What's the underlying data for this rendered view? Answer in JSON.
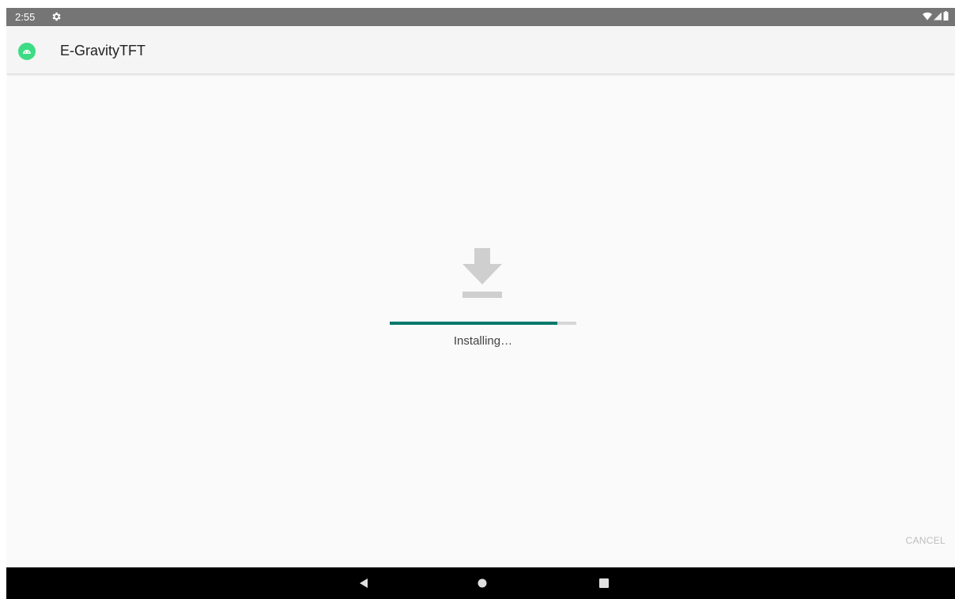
{
  "status_bar": {
    "time": "2:55",
    "icons": [
      "gear-icon",
      "wifi-icon",
      "cell-signal-icon",
      "battery-icon"
    ]
  },
  "app_bar": {
    "title": "E-GravityTFT",
    "icon": "android-app-icon",
    "icon_color": "#3ddc84"
  },
  "install": {
    "icon": "download-icon",
    "progress": 0.9,
    "progress_color": "#00796b",
    "status_text": "Installing…"
  },
  "actions": {
    "cancel_label": "CANCEL"
  },
  "nav_bar": {
    "buttons": [
      "back-icon",
      "home-icon",
      "recents-icon"
    ]
  }
}
